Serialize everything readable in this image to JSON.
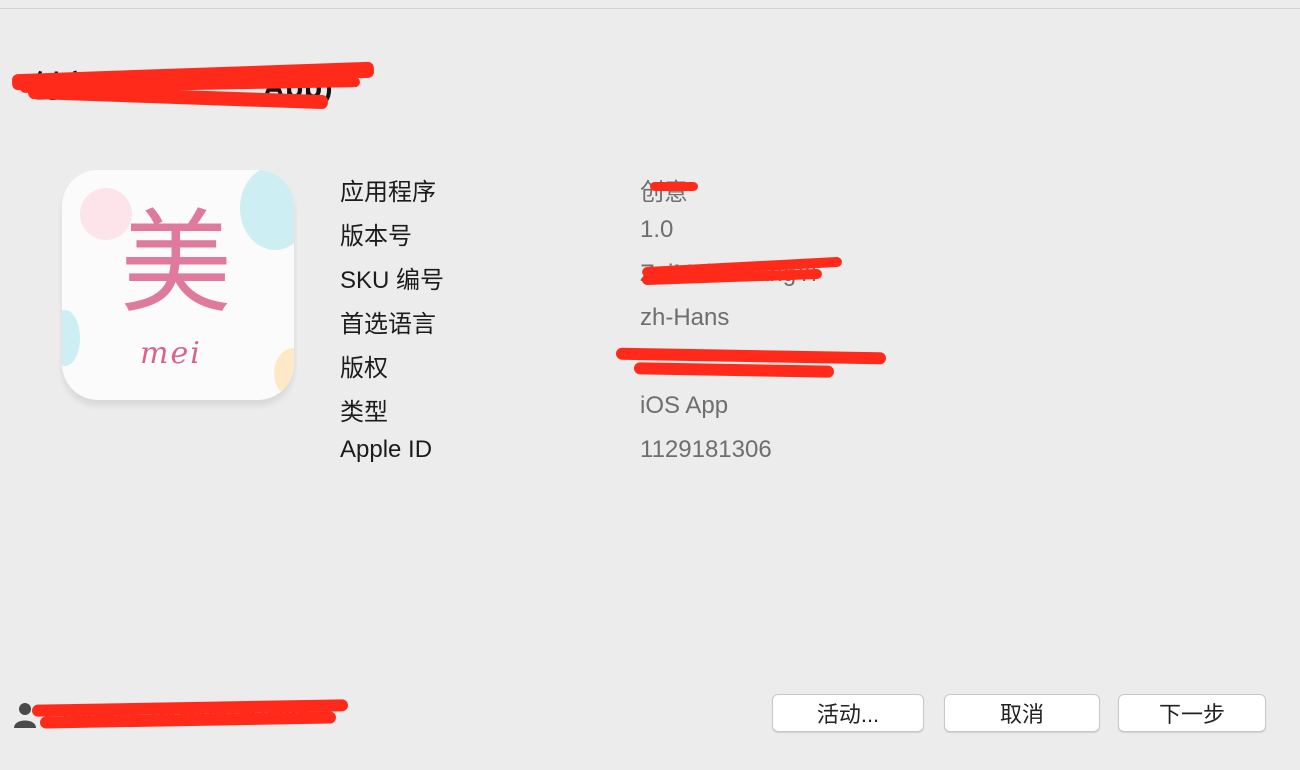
{
  "header": {
    "app_title": "创意__________App)"
  },
  "app_icon": {
    "glyph": "美",
    "word": "mei"
  },
  "info": [
    {
      "label": "应用程序",
      "value": "创意"
    },
    {
      "label": "版本号",
      "value": "1.0"
    },
    {
      "label": "SKU 编号",
      "value": "ZuiMeiChuangYi"
    },
    {
      "label": "首选语言",
      "value": "zh-Hans"
    },
    {
      "label": "版权",
      "value": "______________"
    },
    {
      "label": "类型",
      "value": "iOS App"
    },
    {
      "label": "Apple ID",
      "value": "1129181306"
    }
  ],
  "footer": {
    "account_email": "zyiceuu_1000@100.com",
    "activity_button": "活动...",
    "cancel_button": "取消",
    "next_button": "下一步"
  },
  "colors": {
    "window_bg": "#ececec",
    "redaction": "#ff2a1a",
    "icon_pink": "#e07a9c"
  },
  "icons": {
    "account": "user-silhouette-icon"
  }
}
